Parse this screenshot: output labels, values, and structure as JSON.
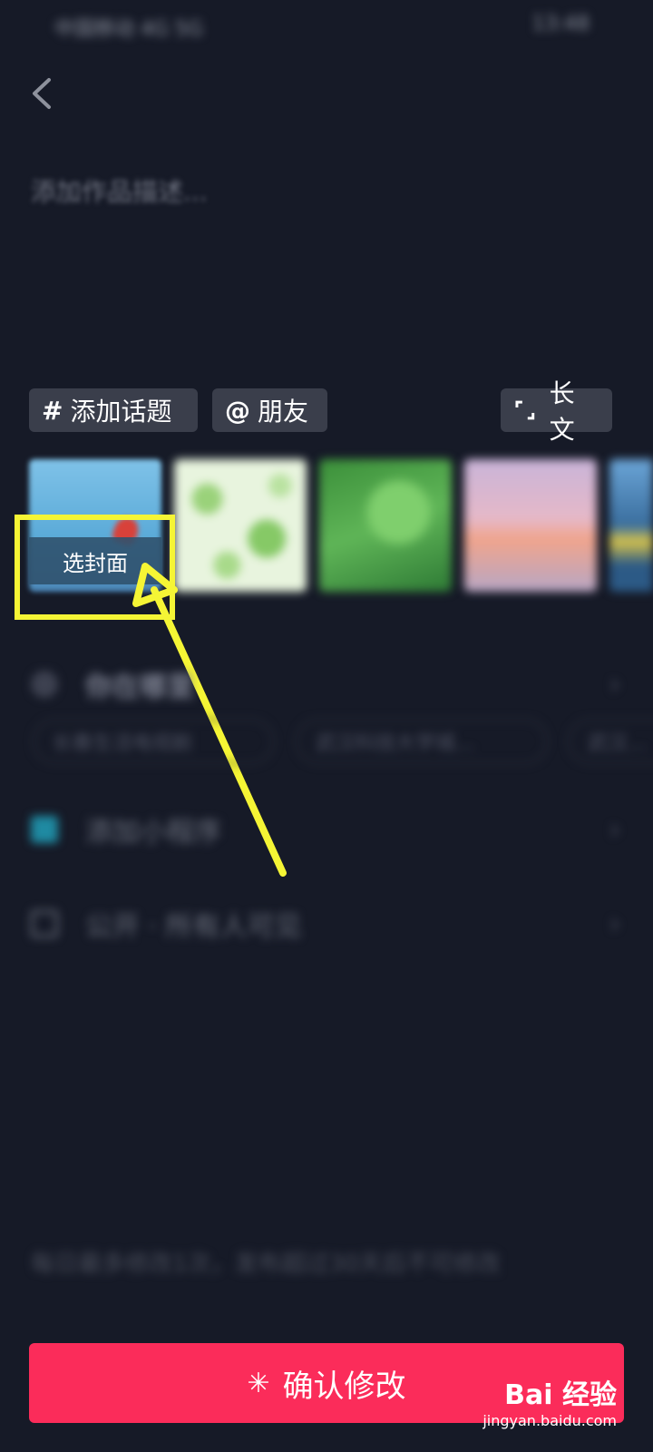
{
  "status": {
    "left": "中国移动 4G 5G",
    "right": "13:48"
  },
  "description": {
    "placeholder": "添加作品描述..."
  },
  "chips": {
    "topic": "添加话题",
    "friends": "朋友",
    "long_text": "长文"
  },
  "cover": {
    "label": "选封面"
  },
  "rows": {
    "location": "你在哪里",
    "mini_program": "添加小程序",
    "privacy": "公开 · 所有人可见"
  },
  "location_tags": [
    "长春生活电视剧",
    "武汉科技大学城...",
    "武汉..."
  ],
  "footer_note": "每日最多修改1次，发布超过30天后不可修改",
  "confirm": {
    "label": "确认修改"
  },
  "watermark": {
    "logo": "Bai 经验",
    "sub": "jingyan.baidu.com"
  },
  "colors": {
    "background": "#161a27",
    "confirm": "#fb2c5a",
    "highlight": "#f5f535"
  }
}
